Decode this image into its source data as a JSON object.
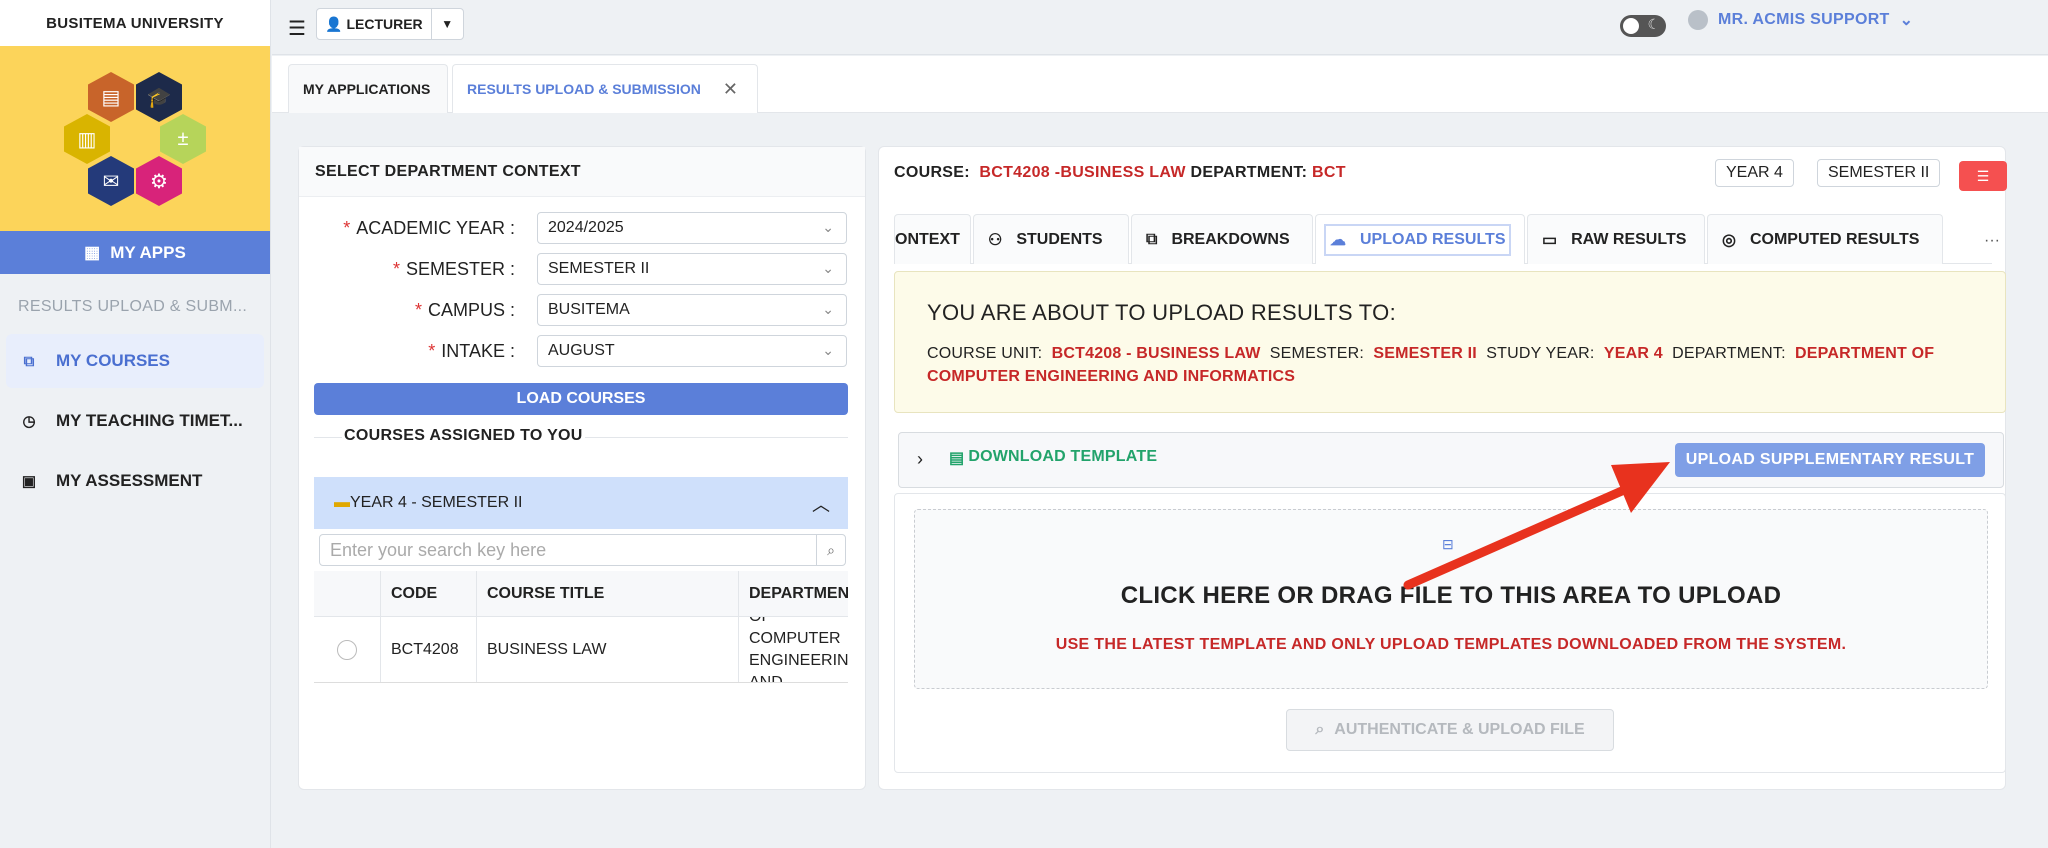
{
  "sidebar": {
    "university": "BUSITEMA UNIVERSITY",
    "my_apps": "MY APPS",
    "breadcrumb": "RESULTS UPLOAD & SUBM...",
    "items": [
      {
        "label": "MY COURSES",
        "icon": "sitemap-icon"
      },
      {
        "label": "MY TEACHING TIMET...",
        "icon": "clock-icon"
      },
      {
        "label": "MY ASSESSMENT",
        "icon": "clipboard-icon"
      }
    ]
  },
  "topbar": {
    "role": "LECTURER",
    "user": "MR. ACMIS SUPPORT"
  },
  "page_tabs": [
    {
      "label": "MY APPLICATIONS"
    },
    {
      "label": "RESULTS UPLOAD & SUBMISSION"
    }
  ],
  "context": {
    "title": "SELECT DEPARTMENT CONTEXT",
    "fields": [
      {
        "label": "ACADEMIC YEAR",
        "value": "2024/2025"
      },
      {
        "label": "SEMESTER",
        "value": "SEMESTER II"
      },
      {
        "label": "CAMPUS",
        "value": "BUSITEMA"
      },
      {
        "label": "INTAKE",
        "value": "AUGUST"
      }
    ],
    "load_button": "LOAD COURSES",
    "assigned_title": "COURSES ASSIGNED TO YOU",
    "year_panel": "YEAR 4 - SEMESTER II",
    "search_placeholder": "Enter your search key here",
    "table": {
      "headers": [
        "CODE",
        "COURSE TITLE",
        "DEPARTMENT"
      ],
      "rows": [
        {
          "code": "BCT4208",
          "title": "BUSINESS LAW",
          "department": "DEPARTMENT OF COMPUTER ENGINEERING AND INFORMATICS"
        }
      ]
    }
  },
  "course": {
    "course_label": "COURSE:",
    "course_value": "BCT4208 -BUSINESS LAW",
    "department_label": "DEPARTMENT:",
    "department_value": "BCT",
    "year_tag": "YEAR 4",
    "semester_tag": "SEMESTER II"
  },
  "inner_tabs": [
    {
      "label": "ONTEXT"
    },
    {
      "label": "STUDENTS"
    },
    {
      "label": "BREAKDOWNS"
    },
    {
      "label": "UPLOAD RESULTS"
    },
    {
      "label": "RAW RESULTS"
    },
    {
      "label": "COMPUTED RESULTS"
    }
  ],
  "more_label": "···",
  "notice": {
    "title": "YOU ARE ABOUT TO UPLOAD RESULTS TO:",
    "course_unit_label": "COURSE UNIT:",
    "course_unit_value": "BCT4208 - BUSINESS LAW",
    "semester_label": "SEMESTER:",
    "semester_value": "SEMESTER II",
    "study_year_label": "STUDY YEAR:",
    "study_year_value": "YEAR 4",
    "department_label": "DEPARTMENT:",
    "department_value": "DEPARTMENT OF COMPUTER ENGINEERING AND INFORMATICS"
  },
  "download_template": "DOWNLOAD TEMPLATE",
  "upload_supplementary": "UPLOAD SUPPLEMENTARY RESULT",
  "dropzone": {
    "title": "CLICK HERE OR DRAG FILE TO THIS AREA TO UPLOAD",
    "subtitle": "USE THE LATEST TEMPLATE AND ONLY UPLOAD TEMPLATES DOWNLOADED FROM THE SYSTEM."
  },
  "auth_button": "AUTHENTICATE & UPLOAD FILE",
  "colors": {
    "accent": "#5b7fd9",
    "danger": "#c62828",
    "success": "#22a36b",
    "arrow": "#e8321e"
  }
}
